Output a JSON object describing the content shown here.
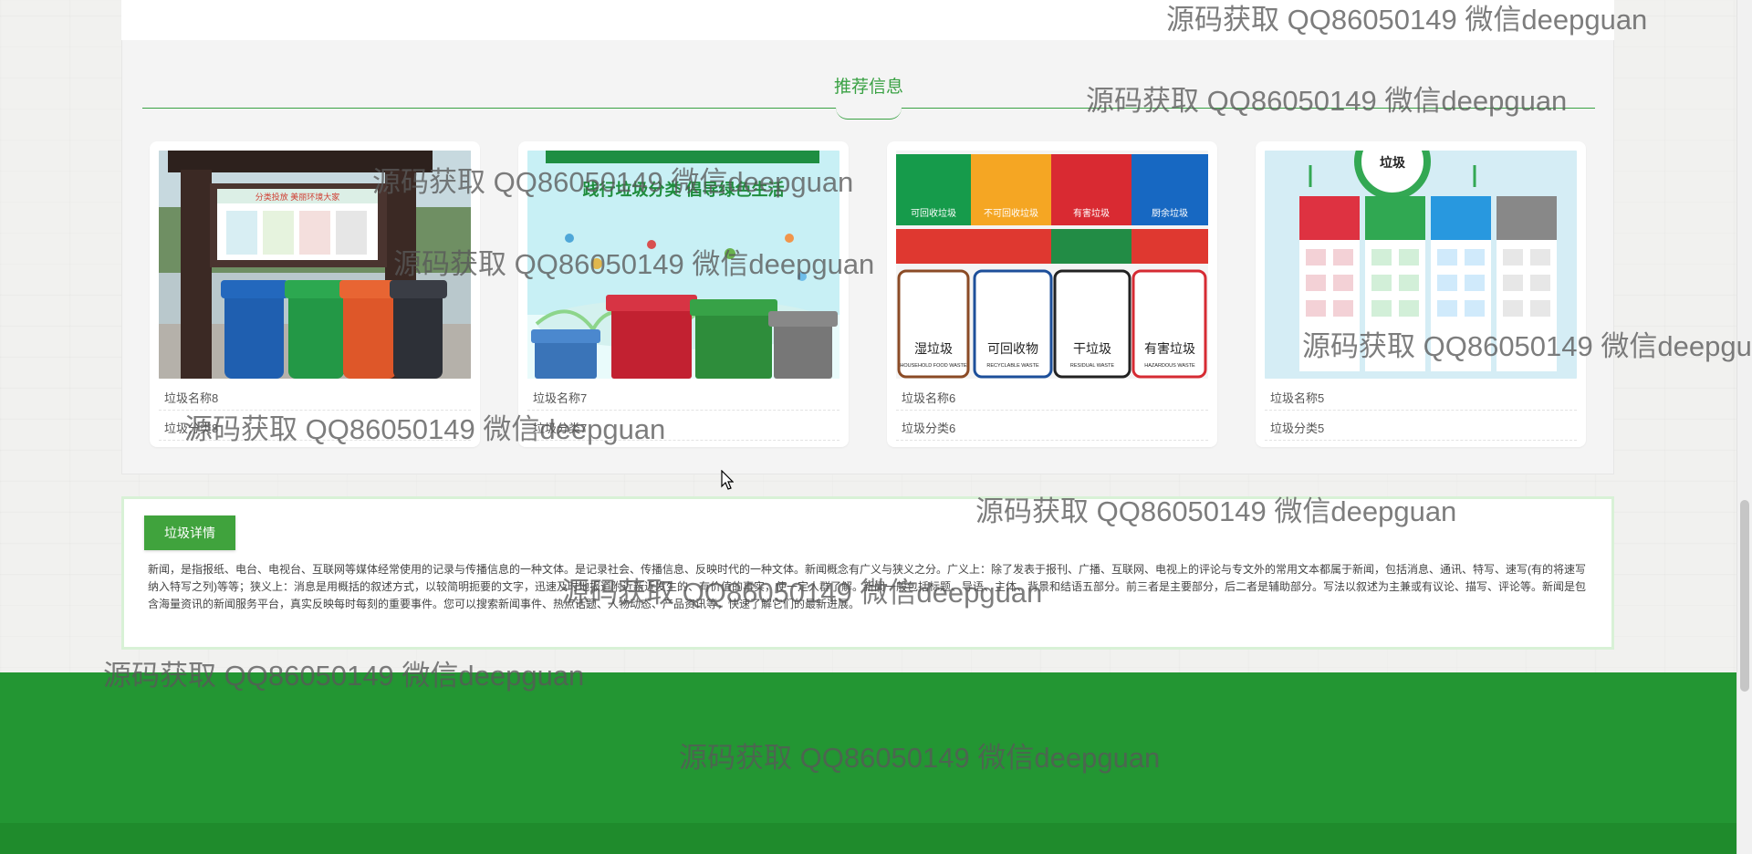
{
  "recommend": {
    "title": "推荐信息",
    "cards": [
      {
        "name": "垃圾名称8",
        "type": "垃圾分类8",
        "image_text": "分类投放 美丽环境大家"
      },
      {
        "name": "垃圾名称7",
        "type": "垃圾分类7",
        "image_title": "践行垃圾分类 倡导绿色生活"
      },
      {
        "name": "垃圾名称6",
        "type": "垃圾分类6",
        "labels": [
          "可回收垃圾",
          "不可回收垃圾",
          "有害垃圾",
          "厨余垃圾",
          "湿垃圾",
          "HOUSEHOLD FOOD WASTE",
          "可回收物",
          "RECYCLABLE WASTE",
          "干垃圾",
          "RESIDUAL WASTE",
          "有害垃圾",
          "HAZARDOUS WASTE"
        ]
      },
      {
        "name": "垃圾名称5",
        "type": "垃圾分类5",
        "image_title": "垃圾"
      }
    ]
  },
  "detail": {
    "tab_label": "垃圾详情",
    "text": "新闻，是指报纸、电台、电视台、互联网等媒体经常使用的记录与传播信息的一种文体。是记录社会、传播信息、反映时代的一种文体。新闻概念有广义与狭义之分。广义上：除了发表于报刊、广播、互联网、电视上的评论与专文外的常用文本都属于新闻，包括消息、通讯、特写、速写(有的将速写纳入特写之列)等等；狭义上：消息是用概括的叙述方式，以较简明扼要的文字，迅速及时地报道附近新近发生的、有价值的事实，使一定人群了解。新闻一般包括标题、导语、主体、背景和结语五部分。前三者是主要部分，后二者是辅助部分。写法以叙述为主兼或有议论、描写、评论等。新闻是包含海量资讯的新闻服务平台，真实反映每时每刻的重要事件。您可以搜索新闻事件、热点话题、人物动态、产品资讯等，快速了解它们的最新进展。"
  },
  "watermark": {
    "text": "源码获取 QQ86050149 微信deepguan"
  },
  "colors": {
    "accent_green": "#39a143",
    "footer_green": "#239633",
    "footer_bottom_green": "#1f8b2c"
  }
}
